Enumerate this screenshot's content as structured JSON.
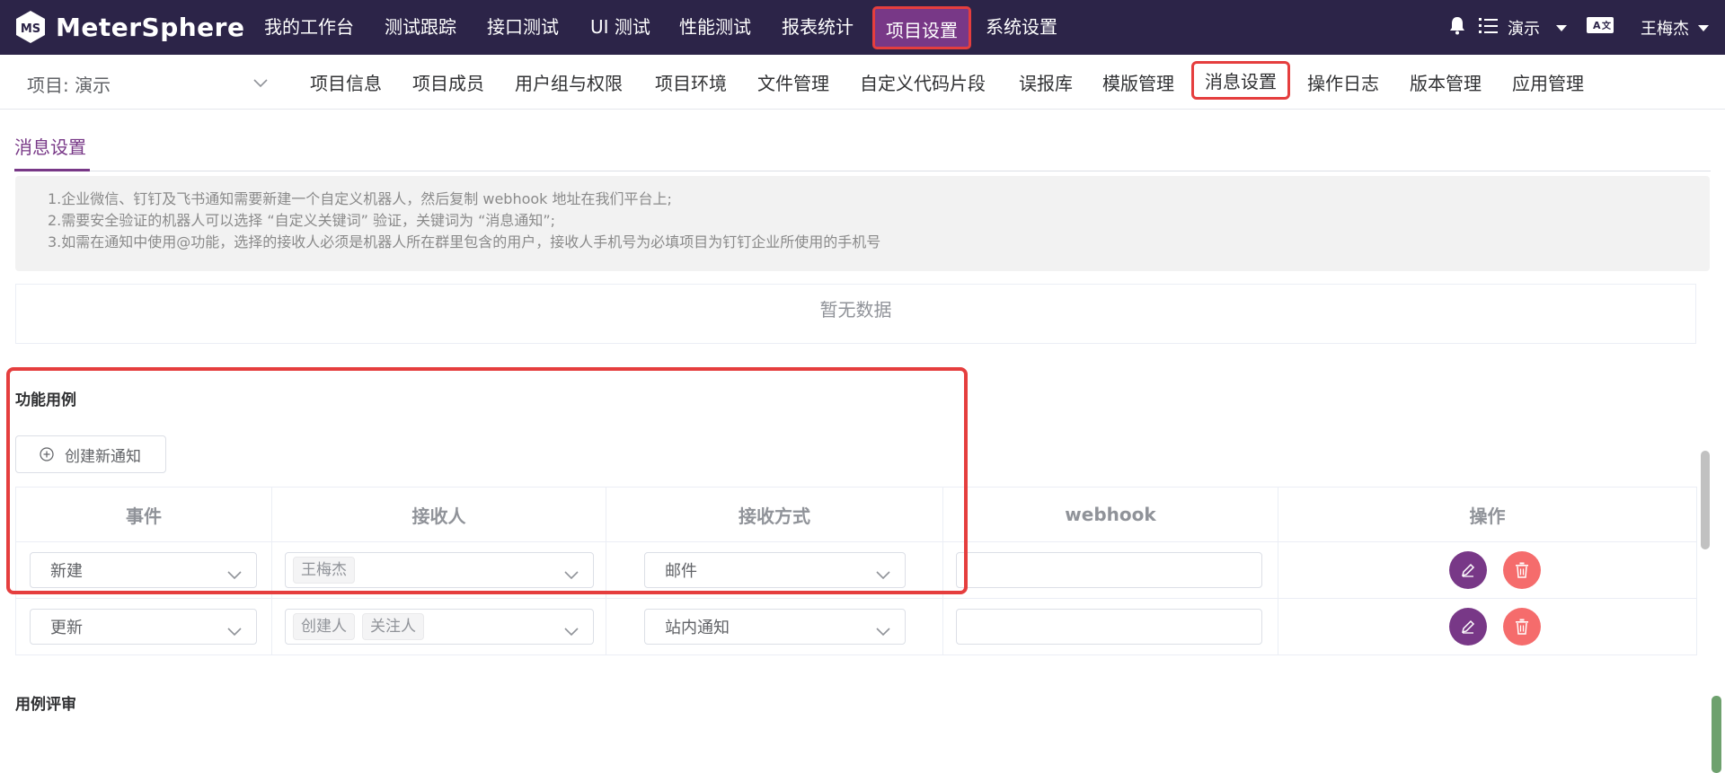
{
  "app": {
    "name": "MeterSphere"
  },
  "topnav": {
    "items": [
      "我的工作台",
      "测试跟踪",
      "接口测试",
      "UI 测试",
      "性能测试",
      "报表统计",
      "项目设置",
      "系统设置"
    ],
    "workspace": "演示",
    "user": "王梅杰"
  },
  "subnav": {
    "project_label": "项目: 演示",
    "items": [
      "项目信息",
      "项目成员",
      "用户组与权限",
      "项目环境",
      "文件管理",
      "自定义代码片段",
      "误报库",
      "模版管理",
      "消息设置",
      "操作日志",
      "版本管理",
      "应用管理"
    ]
  },
  "tab": {
    "label": "消息设置"
  },
  "tips": [
    "1.企业微信、钉钉及飞书通知需要新建一个自定义机器人，然后复制 webhook 地址在我们平台上;",
    "2.需要安全验证的机器人可以选择 “自定义关键词” 验证，关键词为 “消息通知”;",
    "3.如需在通知中使用@功能，选择的接收人必须是机器人所在群里包含的用户，接收人手机号为必填项目为钉钉企业所使用的手机号"
  ],
  "empty_text": "暂无数据",
  "sections": {
    "functional_case": {
      "title": "功能用例",
      "create_button": "创建新通知",
      "columns": [
        "事件",
        "接收人",
        "接收方式",
        "webhook",
        "操作"
      ],
      "rows": [
        {
          "event": "新建",
          "receivers": [
            "王梅杰"
          ],
          "method": "邮件",
          "webhook": ""
        },
        {
          "event": "更新",
          "receivers": [
            "创建人",
            "关注人"
          ],
          "method": "站内通知",
          "webhook": ""
        }
      ]
    },
    "case_review": {
      "title": "用例评审"
    }
  },
  "colors": {
    "topbar_bg": "#2c2448",
    "accent": "#783887",
    "danger": "#f56c6c",
    "highlight": "#e53e3e"
  }
}
